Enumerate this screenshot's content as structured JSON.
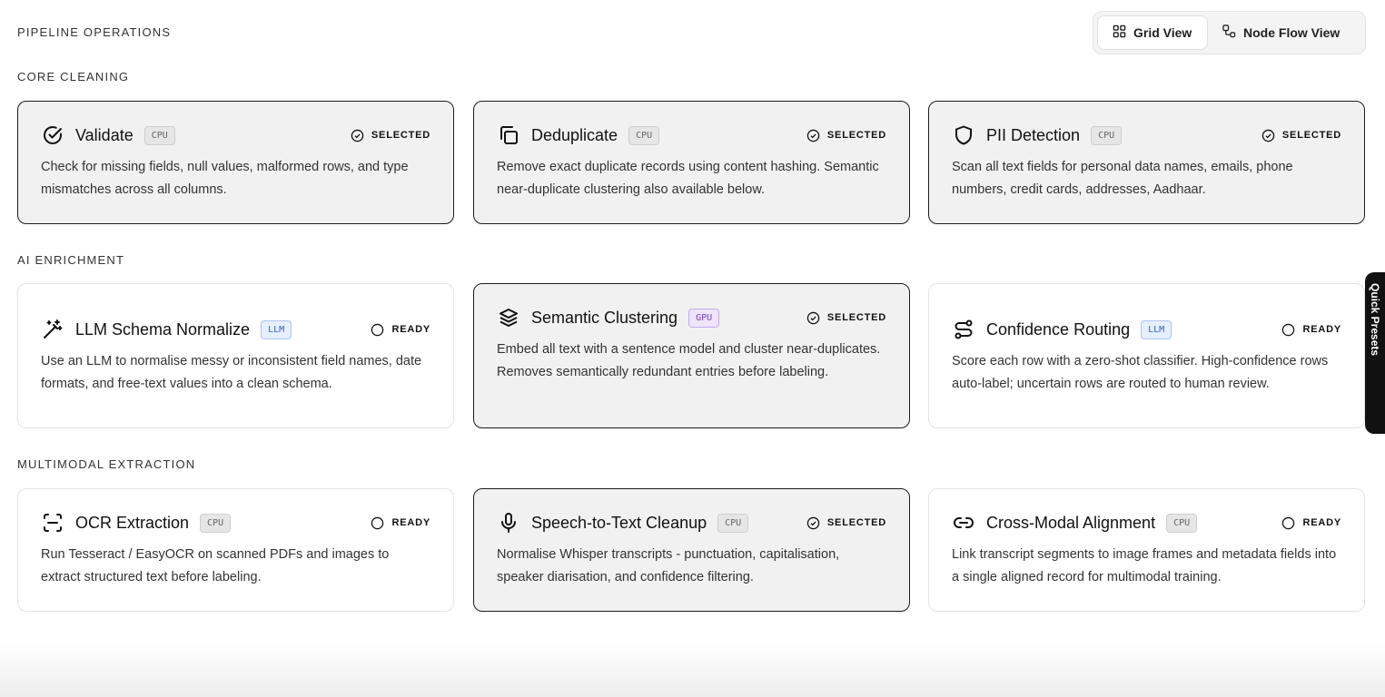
{
  "header": {
    "title": "PIPELINE OPERATIONS",
    "views": [
      {
        "label": "Grid View",
        "icon": "grid-icon",
        "active": true
      },
      {
        "label": "Node Flow View",
        "icon": "node-flow-icon",
        "active": false
      }
    ]
  },
  "sections": [
    {
      "title": "CORE CLEANING",
      "cards": [
        {
          "icon": "check-circle-icon",
          "title": "Validate",
          "tag": "CPU",
          "status": "SELECTED",
          "desc": "Check for missing fields, null values, malformed rows, and type mismatches across all columns."
        },
        {
          "icon": "copy-icon",
          "title": "Deduplicate",
          "tag": "CPU",
          "status": "SELECTED",
          "desc": "Remove exact duplicate records using content hashing. Semantic near-duplicate clustering also available below."
        },
        {
          "icon": "shield-icon",
          "title": "PII Detection",
          "tag": "CPU",
          "status": "SELECTED",
          "desc": "Scan all text fields for personal data names, emails, phone numbers, credit cards, addresses, Aadhaar."
        }
      ]
    },
    {
      "title": "AI ENRICHMENT",
      "cards": [
        {
          "icon": "magic-wand-icon",
          "title": "LLM Schema Normalize",
          "tag": "LLM",
          "status": "READY",
          "desc": "Use an LLM to normalise messy or inconsistent field names, date formats, and free-text values into a clean schema."
        },
        {
          "icon": "layers-icon",
          "title": "Semantic Clustering",
          "tag": "GPU",
          "status": "SELECTED",
          "desc": "Embed all text with a sentence model and cluster near-duplicates. Removes semantically redundant entries before labeling."
        },
        {
          "icon": "route-icon",
          "title": "Confidence Routing",
          "tag": "LLM",
          "status": "READY",
          "desc": "Score each row with a zero-shot classifier. High-confidence rows auto-label; uncertain rows are routed to human review."
        }
      ]
    },
    {
      "title": "MULTIMODAL EXTRACTION",
      "cards": [
        {
          "icon": "scan-icon",
          "title": "OCR Extraction",
          "tag": "CPU",
          "status": "READY",
          "desc": "Run Tesseract / EasyOCR on scanned PDFs and images to extract structured text before labeling."
        },
        {
          "icon": "microphone-icon",
          "title": "Speech-to-Text Cleanup",
          "tag": "CPU",
          "status": "SELECTED",
          "desc": "Normalise Whisper transcripts - punctuation, capitalisation, speaker diarisation, and confidence filtering."
        },
        {
          "icon": "link-icon",
          "title": "Cross-Modal Alignment",
          "tag": "CPU",
          "status": "READY",
          "desc": "Link transcript segments to image frames and metadata fields into a single aligned record for multimodal training."
        }
      ]
    }
  ],
  "side_tab": {
    "label": "Quick Presets",
    "icon": "sparkle-icon"
  }
}
